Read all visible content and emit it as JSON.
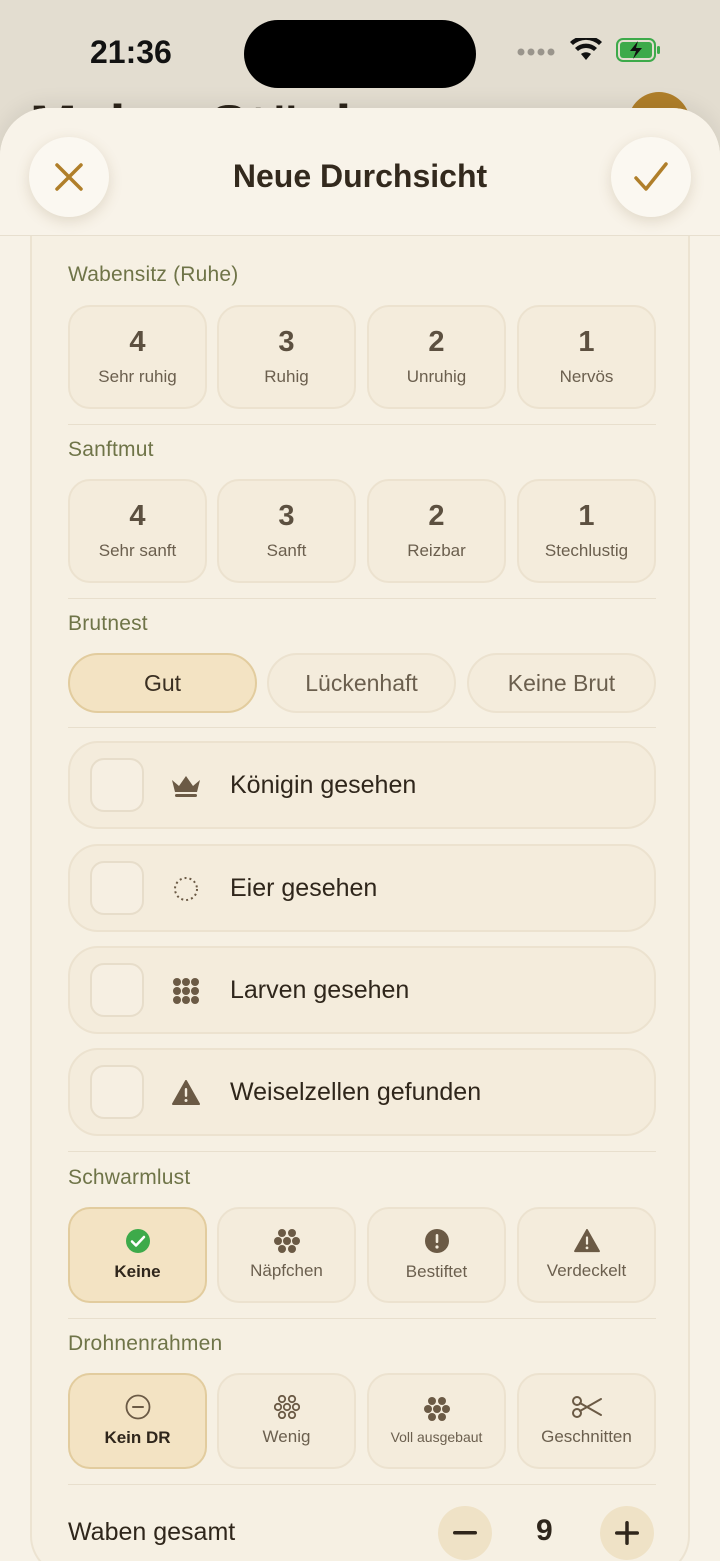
{
  "status": {
    "time": "21:36"
  },
  "background": {
    "title": "Meine Stöcke"
  },
  "header": {
    "title": "Neue Durchsicht"
  },
  "wabensitz": {
    "label": "Wabensitz (Ruhe)",
    "options": [
      {
        "value": "4",
        "text": "Sehr ruhig"
      },
      {
        "value": "3",
        "text": "Ruhig"
      },
      {
        "value": "2",
        "text": "Unruhig"
      },
      {
        "value": "1",
        "text": "Nervös"
      }
    ]
  },
  "sanftmut": {
    "label": "Sanftmut",
    "options": [
      {
        "value": "4",
        "text": "Sehr sanft"
      },
      {
        "value": "3",
        "text": "Sanft"
      },
      {
        "value": "2",
        "text": "Reizbar"
      },
      {
        "value": "1",
        "text": "Stechlustig"
      }
    ]
  },
  "brutnest": {
    "label": "Brutnest",
    "options": [
      "Gut",
      "Lückenhaft",
      "Keine Brut"
    ],
    "selected": "Gut"
  },
  "checks": [
    {
      "label": "Königin gesehen",
      "icon": "crown-icon",
      "checked": false
    },
    {
      "label": "Eier gesehen",
      "icon": "egg-dotted-circle-icon",
      "checked": false
    },
    {
      "label": "Larven gesehen",
      "icon": "larvae-grid-icon",
      "checked": false
    },
    {
      "label": "Weiselzellen gefunden",
      "icon": "warning-triangle-icon",
      "checked": false
    }
  ],
  "schwarmlust": {
    "label": "Schwarmlust",
    "options": [
      "Keine",
      "Näpfchen",
      "Bestiftet",
      "Verdeckelt"
    ],
    "selected": "Keine"
  },
  "drohnenrahmen": {
    "label": "Drohnenrahmen",
    "options": [
      "Kein DR",
      "Wenig",
      "Voll ausgebaut",
      "Geschnitten"
    ],
    "selected": "Kein DR"
  },
  "waben": {
    "label": "Waben gesamt",
    "value": "9"
  },
  "colors": {
    "accent": "#b07f2a",
    "sheet_bg": "#f7f2e7",
    "selected_bg": "#f3e3c3",
    "success": "#3daa4a",
    "label_green": "#6f7448"
  }
}
